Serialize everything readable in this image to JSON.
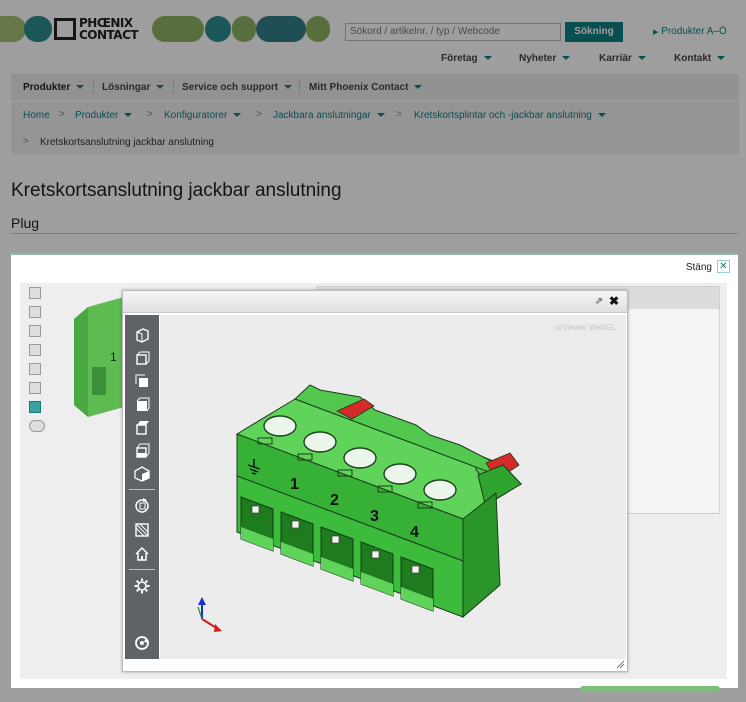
{
  "header": {
    "logo_line1": "PHŒNIX",
    "logo_line2": "CONTACT",
    "search_placeholder": "Sökord / artikelnr. / typ / Webcode",
    "search_button": "Sökning",
    "products_az": "Produkter A–Ö",
    "pill_colors": [
      "#a3c171",
      "#2d8b8e",
      "#8fb463",
      "#327f8a"
    ]
  },
  "topnav": [
    {
      "label": "Företag"
    },
    {
      "label": "Nyheter"
    },
    {
      "label": "Karriär"
    },
    {
      "label": "Kontakt"
    }
  ],
  "mainnav": [
    {
      "label": "Produkter"
    },
    {
      "label": "Lösningar"
    },
    {
      "label": "Service och support"
    },
    {
      "label": "Mitt Phoenix Contact"
    }
  ],
  "breadcrumb": {
    "items": [
      {
        "label": "Home"
      },
      {
        "label": "Produkter"
      },
      {
        "label": "Konfiguratorer"
      },
      {
        "label": "Jackbara anslutningar"
      },
      {
        "label": "Kretskortsplintar och -jackbar anslutning"
      }
    ],
    "current": "Kretskortsanslutning jackbar anslutning"
  },
  "page": {
    "title": "Kretskortsanslutning jackbar anslutning",
    "subtitle": "Plug"
  },
  "modal": {
    "close_label": "Stäng",
    "close_icon": "close-icon"
  },
  "viewer": {
    "watermark": "ccViewer WebGL",
    "pin_numbers": [
      "1",
      "2",
      "3",
      "4"
    ],
    "connector_color": "#3ec43e",
    "accent_color": "#d42a2a",
    "toolbar_icons": [
      "view-iso-icon",
      "view-front-icon",
      "view-left-icon",
      "view-top-icon",
      "view-right-icon",
      "view-bottom-icon",
      "shading-icon",
      "rotate-icon",
      "section-icon",
      "home-icon",
      "settings-icon",
      "reset-icon"
    ]
  }
}
